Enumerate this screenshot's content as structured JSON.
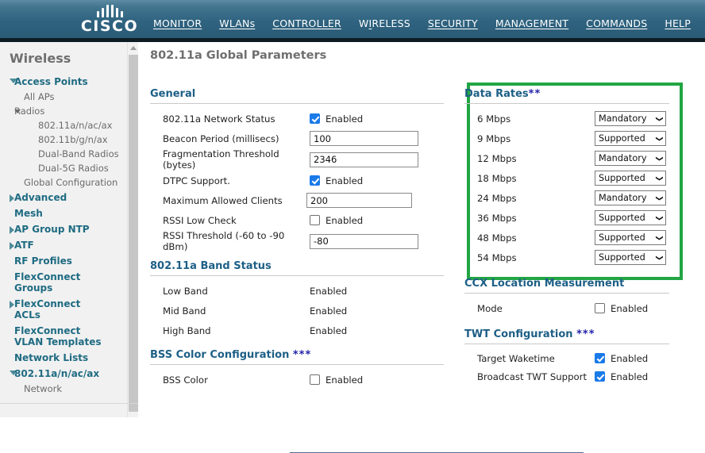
{
  "banner": {
    "logo_text": "CISCO",
    "logo_icon": "cisco-bridge-logo"
  },
  "nav": {
    "items": [
      {
        "label": "MONITOR",
        "mnemonic_index": 0,
        "active": false
      },
      {
        "label": "WLANs",
        "mnemonic_index": 0,
        "active": false
      },
      {
        "label": "CONTROLLER",
        "mnemonic_index": 0,
        "active": false
      },
      {
        "label": "WIRELESS",
        "mnemonic_index": 1,
        "active": true
      },
      {
        "label": "SECURITY",
        "mnemonic_index": 0,
        "active": false
      },
      {
        "label": "MANAGEMENT",
        "mnemonic_index": 2,
        "active": false
      },
      {
        "label": "COMMANDS",
        "mnemonic_index": 1,
        "active": false
      },
      {
        "label": "HELP",
        "mnemonic_index": 3,
        "active": false
      }
    ]
  },
  "sidebar": {
    "title": "Wireless",
    "items": [
      {
        "label": "Access Points",
        "level": 0,
        "type": "branch",
        "arrow": "down"
      },
      {
        "label": "All APs",
        "level": 1,
        "type": "leaf"
      },
      {
        "label": "Radios",
        "level": 1,
        "type": "branch-small",
        "arrow": "down-small"
      },
      {
        "label": "802.11a/n/ac/ax",
        "level": 2,
        "type": "leaf"
      },
      {
        "label": "802.11b/g/n/ax",
        "level": 2,
        "type": "leaf"
      },
      {
        "label": "Dual-Band Radios",
        "level": 2,
        "type": "leaf"
      },
      {
        "label": "Dual-5G Radios",
        "level": 2,
        "type": "leaf"
      },
      {
        "label": "Global Configuration",
        "level": 1,
        "type": "leaf"
      },
      {
        "label": "Advanced",
        "level": 0,
        "type": "branch",
        "arrow": "right"
      },
      {
        "label": "Mesh",
        "level": 0,
        "type": "branch",
        "arrow": "none"
      },
      {
        "label": "AP Group NTP",
        "level": 0,
        "type": "branch",
        "arrow": "right"
      },
      {
        "label": "ATF",
        "level": 0,
        "type": "branch",
        "arrow": "right"
      },
      {
        "label": "RF Profiles",
        "level": 0,
        "type": "branch",
        "arrow": "none"
      },
      {
        "label": "FlexConnect Groups",
        "level": 0,
        "type": "branch",
        "arrow": "none"
      },
      {
        "label": "FlexConnect ACLs",
        "level": 0,
        "type": "branch",
        "arrow": "right"
      },
      {
        "label": "FlexConnect VLAN Templates",
        "level": 0,
        "type": "branch",
        "arrow": "none"
      },
      {
        "label": "Network Lists",
        "level": 0,
        "type": "branch",
        "arrow": "none"
      },
      {
        "label": "802.11a/n/ac/ax",
        "level": 0,
        "type": "branch",
        "arrow": "down"
      },
      {
        "label": "Network",
        "level": 1,
        "type": "leaf"
      }
    ]
  },
  "page": {
    "title": "802.11a Global Parameters"
  },
  "general": {
    "heading": "General",
    "network_status": {
      "label": "802.11a Network Status",
      "checkbox_label": "Enabled",
      "checked": true
    },
    "beacon_period": {
      "label": "Beacon Period (millisecs)",
      "value": "100"
    },
    "fragmentation_threshold": {
      "label": "Fragmentation Threshold (bytes)",
      "value": "2346"
    },
    "dtpc_support": {
      "label": "DTPC Support.",
      "checkbox_label": "Enabled",
      "checked": true
    },
    "max_clients": {
      "label": "Maximum Allowed Clients",
      "value": "200"
    },
    "rssi_low_check": {
      "label": "RSSI Low Check",
      "checkbox_label": "Enabled",
      "checked": false
    },
    "rssi_threshold": {
      "label": "RSSI Threshold (-60 to -90 dBm)",
      "value": "-80"
    }
  },
  "band_status": {
    "heading": "802.11a Band Status",
    "rows": [
      {
        "label": "Low Band",
        "value": "Enabled"
      },
      {
        "label": "Mid Band",
        "value": "Enabled"
      },
      {
        "label": "High Band",
        "value": "Enabled"
      }
    ]
  },
  "bss_color": {
    "heading": "BSS Color Configuration",
    "heading_stars": "***",
    "row": {
      "label": "BSS Color",
      "checkbox_label": "Enabled",
      "checked": false
    }
  },
  "data_rates": {
    "heading": "Data Rates",
    "heading_stars": "**",
    "highlight_color": "#22a544",
    "rows": [
      {
        "label": "6 Mbps",
        "value": "Mandatory"
      },
      {
        "label": "9 Mbps",
        "value": "Supported"
      },
      {
        "label": "12 Mbps",
        "value": "Mandatory"
      },
      {
        "label": "18 Mbps",
        "value": "Supported"
      },
      {
        "label": "24 Mbps",
        "value": "Mandatory"
      },
      {
        "label": "36 Mbps",
        "value": "Supported"
      },
      {
        "label": "48 Mbps",
        "value": "Supported"
      },
      {
        "label": "54 Mbps",
        "value": "Supported"
      }
    ]
  },
  "ccx": {
    "heading": "CCX Location Measurement",
    "row": {
      "label": "Mode",
      "checkbox_label": "Enabled",
      "checked": false
    }
  },
  "twt": {
    "heading": "TWT Configuration",
    "heading_stars": "***",
    "rows": [
      {
        "label": "Target Waketime",
        "checkbox_label": "Enabled",
        "checked": true
      },
      {
        "label": "Broadcast TWT Support",
        "checkbox_label": "Enabled",
        "checked": true
      }
    ]
  }
}
